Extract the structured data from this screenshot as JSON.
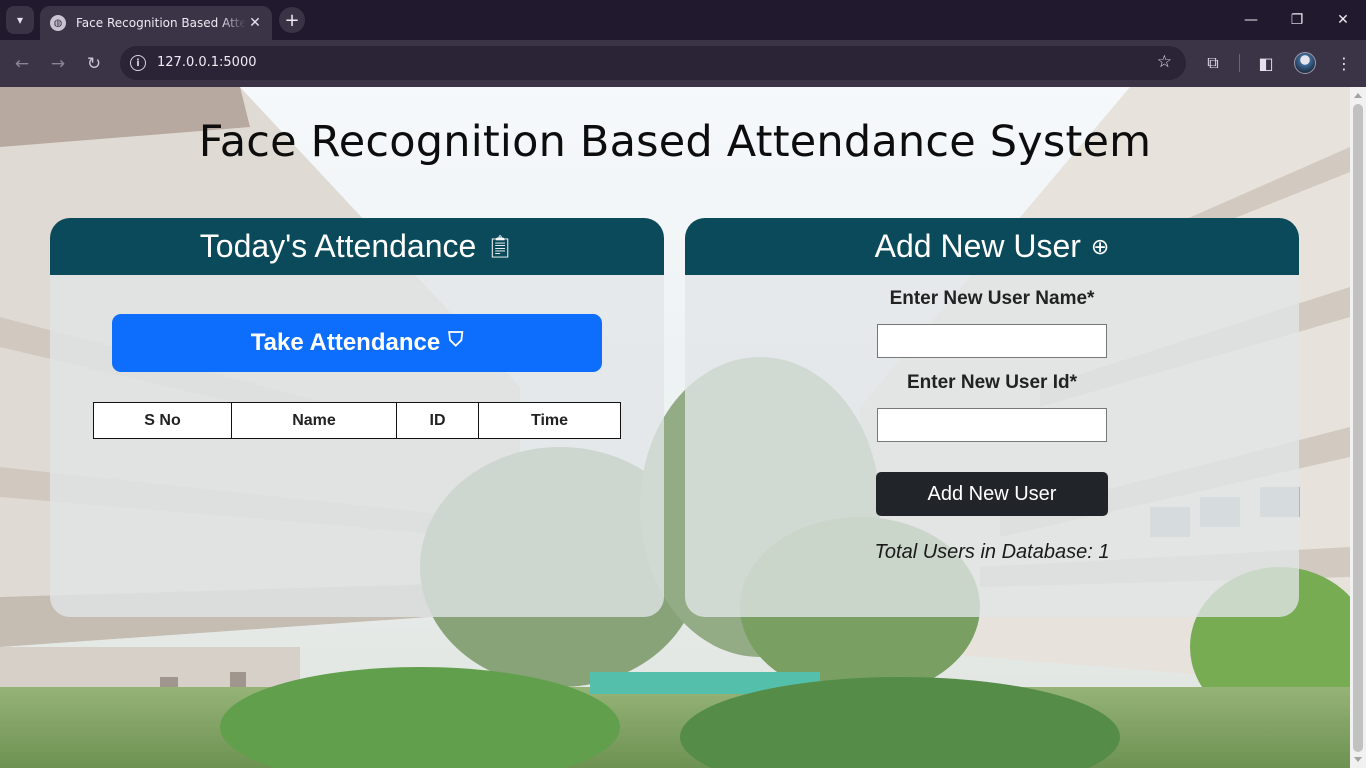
{
  "browser": {
    "tab_title": "Face Recognition Based Attendance System",
    "url": "127.0.0.1:5000",
    "icons": {
      "tab_search": "chevron-down-icon",
      "favicon": "globe-icon",
      "tab_close": "close-icon",
      "new_tab": "plus-icon",
      "minimize": "minimize-icon",
      "maximize": "restore-icon",
      "close": "close-icon",
      "back": "arrow-left-icon",
      "forward": "arrow-right-icon",
      "reload": "reload-icon",
      "site_info": "info-icon",
      "bookmark": "star-icon",
      "extensions": "puzzle-icon",
      "side_panel": "side-panel-icon",
      "menu": "kebab-menu-icon"
    }
  },
  "page": {
    "title": "Face Recognition Based Attendance System"
  },
  "attendance": {
    "heading": "Today's Attendance",
    "heading_icon": "clipboard-icon",
    "take_button": "Take Attendance",
    "take_button_icon": "shield-check-icon",
    "columns": [
      "S No",
      "Name",
      "ID",
      "Time"
    ],
    "rows": []
  },
  "add_user": {
    "heading": "Add New User",
    "heading_icon": "plus-circle-icon",
    "name_label": "Enter New User Name*",
    "name_value": "",
    "id_label": "Enter New User Id*",
    "id_value": "",
    "submit": "Add New User",
    "total_users": "Total Users in Database: 1"
  },
  "colors": {
    "card_header": "#0b4a5a",
    "primary_button": "#0d6efd",
    "dark_button": "#212529"
  }
}
